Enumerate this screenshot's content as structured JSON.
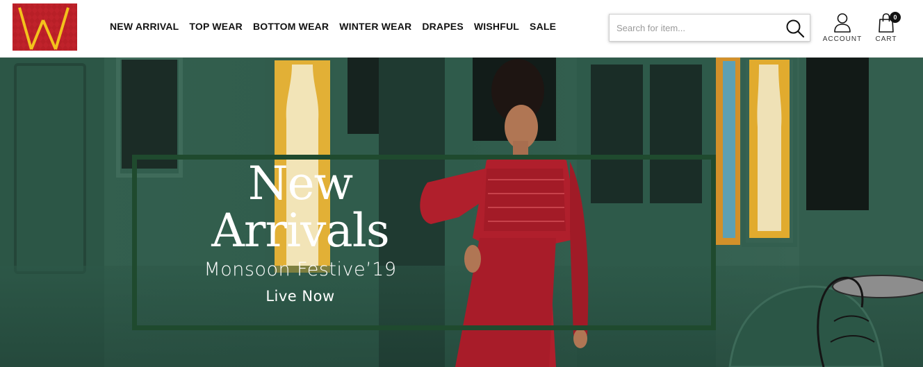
{
  "brand": {
    "logo_icon": "w-brand-logo",
    "colors": {
      "red": "#c0222b",
      "yellow": "#f3c21c"
    }
  },
  "nav": {
    "items": [
      {
        "label": "NEW ARRIVAL"
      },
      {
        "label": "TOP WEAR"
      },
      {
        "label": "BOTTOM WEAR"
      },
      {
        "label": "WINTER WEAR"
      },
      {
        "label": "DRAPES"
      },
      {
        "label": "WISHFUL"
      },
      {
        "label": "SALE"
      }
    ]
  },
  "search": {
    "placeholder": "Search for item...",
    "value": "",
    "icon": "search-icon"
  },
  "account": {
    "label": "ACCOUNT",
    "icon": "user-icon"
  },
  "cart": {
    "label": "CART",
    "count": "0",
    "icon": "shopping-bag-icon"
  },
  "hero": {
    "title_line1": "New",
    "title_line2": "Arrivals",
    "subtitle": "Monsoon Festive’19",
    "cta": "Live Now",
    "frame_color": "#1f4a2e",
    "image": "woman-in-red-dress-photo"
  }
}
